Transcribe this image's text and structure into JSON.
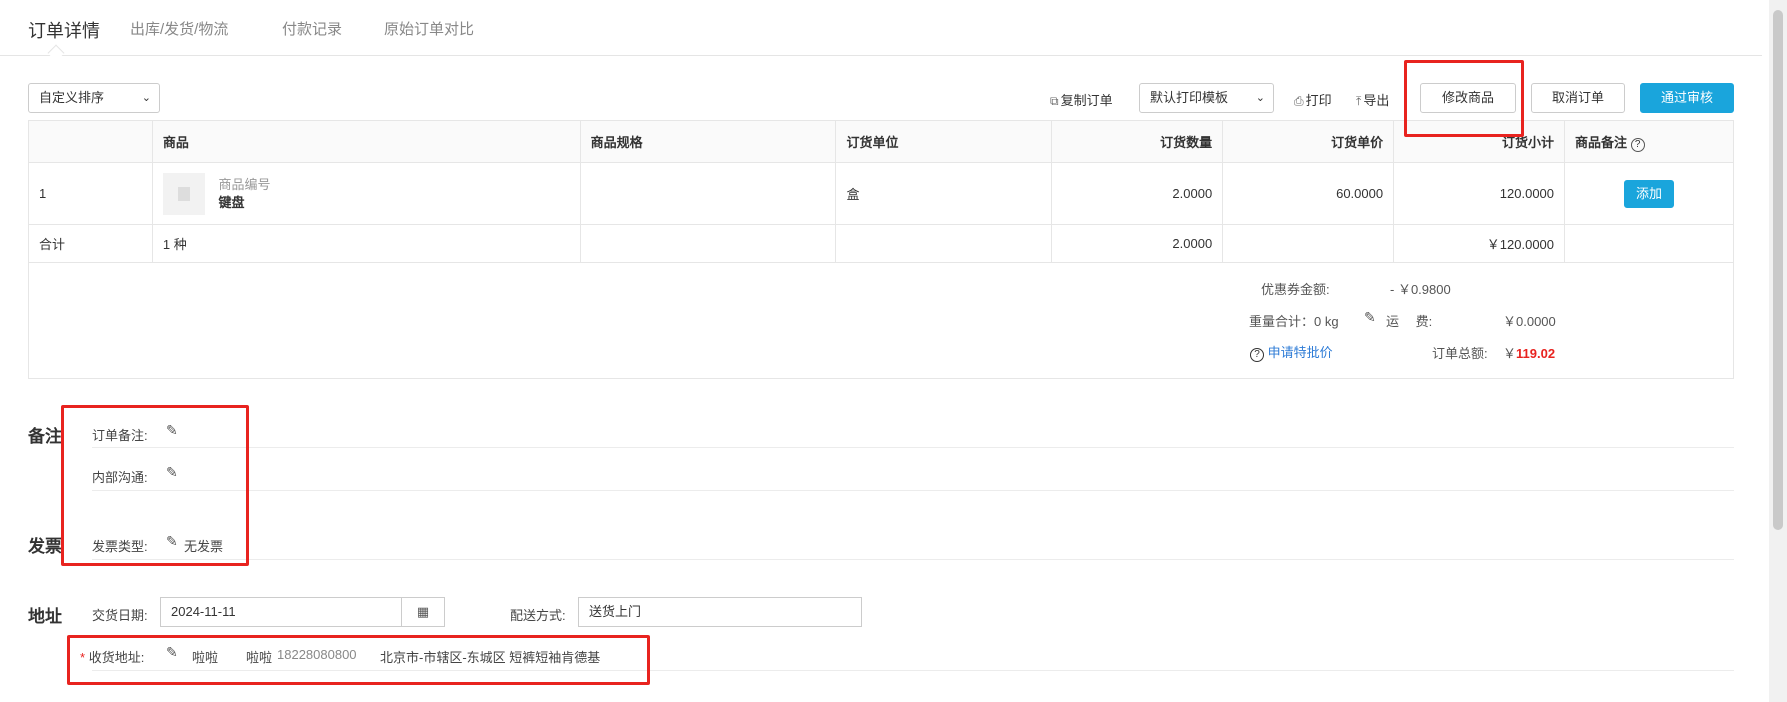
{
  "tabs": [
    "订单详情",
    "出库/发货/物流",
    "付款记录",
    "原始订单对比"
  ],
  "toolbar": {
    "sort_select": "自定义排序",
    "copy_order": "复制订单",
    "print_template": "默认打印模板",
    "print": "打印",
    "export": "导出",
    "modify_goods": "修改商品",
    "cancel_order": "取消订单",
    "approve": "通过审核"
  },
  "table": {
    "headers": [
      "",
      "商品",
      "商品规格",
      "订货单位",
      "订货数量",
      "订货单价",
      "订货小计",
      "商品备注"
    ],
    "row": {
      "index": "1",
      "product_code": "商品编号",
      "product_name": "键盘",
      "spec": "",
      "unit": "盒",
      "qty": "2.0000",
      "price": "60.0000",
      "subtotal": "120.0000",
      "add_button": "添加"
    },
    "total_row": {
      "label": "合计",
      "kinds": "1 种",
      "qty": "2.0000",
      "subtotal": "￥120.0000"
    }
  },
  "summary": {
    "coupon_label": "优惠券金额:",
    "coupon_value": "- ￥0.9800",
    "weight_label": "重量合计：0 kg",
    "freight_label": "运　 费:",
    "freight_value": "￥0.0000",
    "special_price_link": "申请特批价",
    "order_total_label": "订单总额:",
    "order_total_currency": "￥",
    "order_total_value": "119.02"
  },
  "remarks": {
    "section_title": "备注",
    "order_remark_label": "订单备注:",
    "internal_label": "内部沟通:"
  },
  "invoice": {
    "section_title": "发票",
    "type_label": "发票类型:",
    "type_value": "无发票"
  },
  "address": {
    "section_title": "地址",
    "delivery_date_label": "交货日期:",
    "delivery_date_value": "2024-11-11",
    "shipping_method_label": "配送方式:",
    "shipping_method_value": "送货上门",
    "receive_label": "收货地址:",
    "receiver_name": "啦啦",
    "receiver_contact": "啦啦",
    "receiver_phone": "18228080800",
    "receiver_address": "北京市-市辖区-东城区 短裤短袖肯德基"
  }
}
